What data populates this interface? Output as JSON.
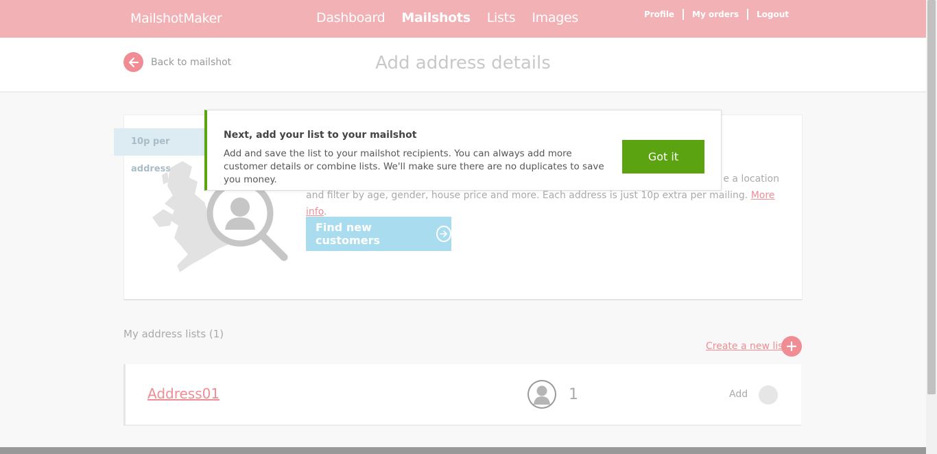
{
  "header": {
    "brand": "MailshotMaker",
    "nav": [
      "Dashboard",
      "Mailshots",
      "Lists",
      "Images"
    ],
    "active_nav": "Mailshots",
    "user_links": {
      "profile": "Profile",
      "orders": "My orders",
      "logout": "Logout"
    }
  },
  "subheader": {
    "back_label": "Back to mailshot",
    "title": "Add address details"
  },
  "promo": {
    "price_tag": "10p per address",
    "text_line1_fragment": "e a location",
    "text_line2": "and filter by age, gender, house price and more. Each address is just 10p extra per mailing.",
    "more_info": "More info",
    "button": "Find new customers"
  },
  "popup": {
    "title": "Next, add your list to your mailshot",
    "body": "Add and save the list to your mailshot recipients. You can always add more customer details or combine lists. We'll make sure there are no duplicates to save you money.",
    "button": "Got it"
  },
  "lists": {
    "heading": "My address lists (1)",
    "create_label": "Create a new list",
    "rows": [
      {
        "name": "Address01",
        "count": "1",
        "add_label": "Add"
      }
    ]
  },
  "colors": {
    "header_bg": "#f2b1b5",
    "accent_pink": "#f08c93",
    "primary_green": "#5ba311",
    "light_blue": "#a9dcee"
  }
}
